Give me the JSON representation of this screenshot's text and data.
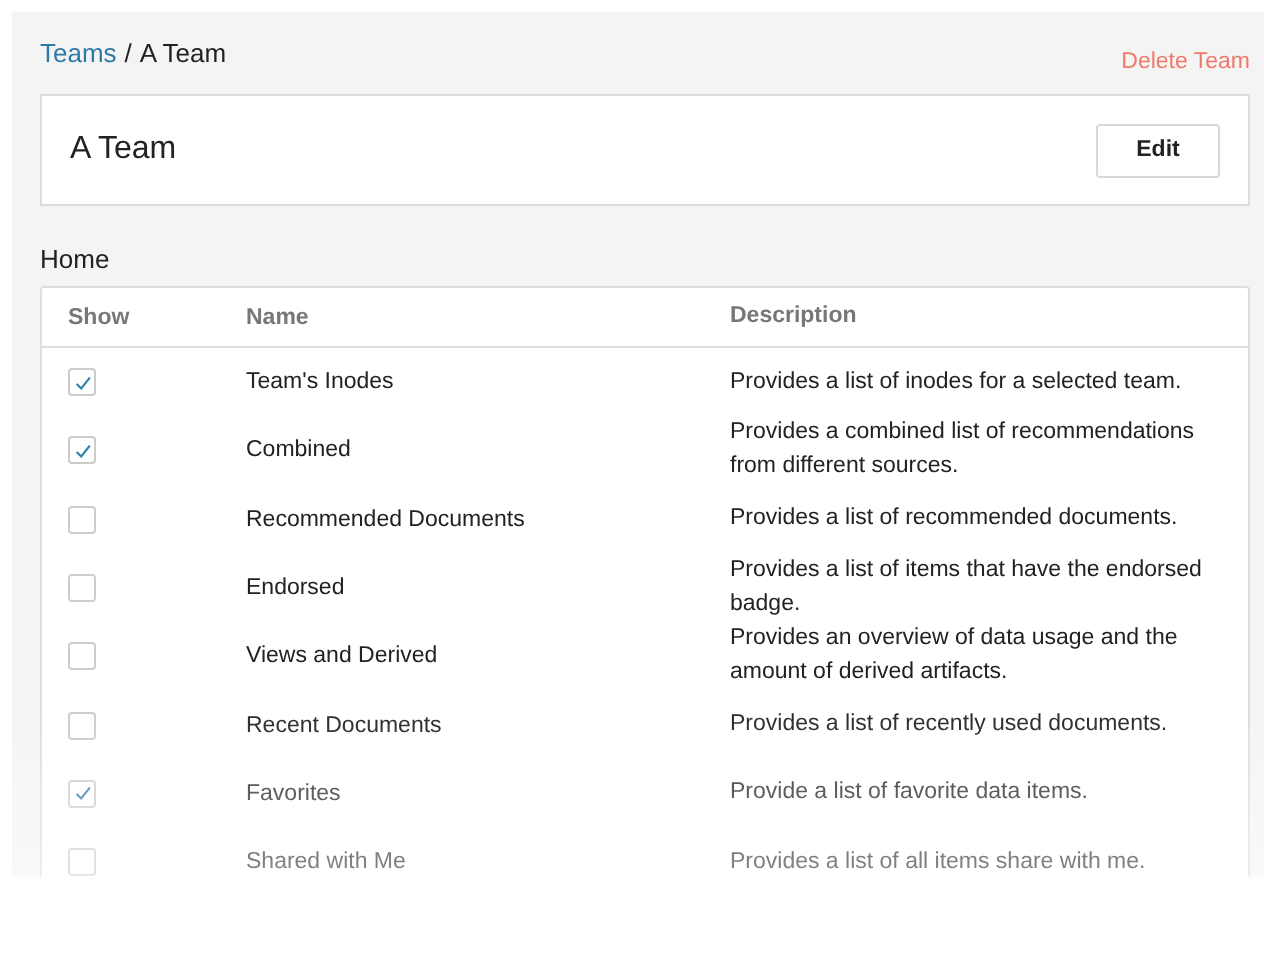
{
  "breadcrumb": {
    "parent": "Teams",
    "separator": "/",
    "current": "A Team"
  },
  "delete_action": "Delete Team",
  "team_card": {
    "title": "A Team",
    "edit_button": "Edit"
  },
  "section_title": "Home",
  "table": {
    "columns": [
      "Show",
      "Name",
      "Description"
    ],
    "rows": [
      {
        "checked": true,
        "name": "Team's Inodes",
        "description": "Provides a list of inodes for a selected team."
      },
      {
        "checked": true,
        "name": "Combined",
        "description": "Provides a combined list of recommendations from different sources."
      },
      {
        "checked": false,
        "name": "Recommended Documents",
        "description": "Provides a list of recommended documents."
      },
      {
        "checked": false,
        "name": "Endorsed",
        "description": "Provides a list of items that have the endorsed badge."
      },
      {
        "checked": false,
        "name": "Views and Derived",
        "description": "Provides an overview of data usage and the amount of derived artifacts."
      },
      {
        "checked": false,
        "name": "Recent Documents",
        "description": "Provides a list of recently used documents."
      },
      {
        "checked": true,
        "name": "Favorites",
        "description": "Provide a list of favorite data items."
      },
      {
        "checked": false,
        "name": "Shared with Me",
        "description": "Provides a list of all items share with me."
      }
    ]
  }
}
